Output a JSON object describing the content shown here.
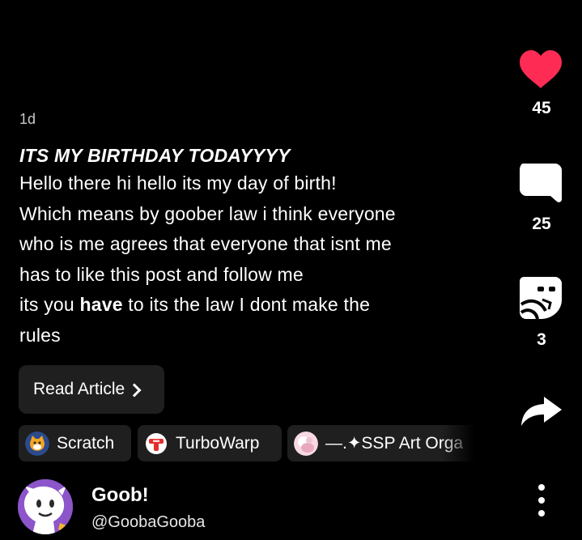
{
  "post": {
    "age": "1d",
    "title": "ITS MY BIRTHDAY TODAYYYY",
    "lines": [
      "Hello there hi hello its my day of birth!",
      "Which means by goober law i think everyone",
      "who is me agrees that everyone that isnt me",
      "has to like this post and follow me"
    ],
    "line5_before": "its you ",
    "line5_bold": "have",
    "line5_after": " to its the law I dont make the",
    "line6": "rules",
    "read_button_label": "Read Article"
  },
  "tags": [
    {
      "label": "Scratch",
      "icon": "scratch-cat-icon"
    },
    {
      "label": "TurboWarp",
      "icon": "turbowarp-icon"
    },
    {
      "label": "—.✦SSP Art Orga",
      "icon": "ssp-art-icon"
    }
  ],
  "author": {
    "name": "Goob!",
    "handle": "@GoobaGooba"
  },
  "actions": {
    "likes": "45",
    "comments": "25",
    "remixes": "3",
    "like_color": "#fe2c55"
  },
  "icons": {
    "like": "heart-icon",
    "comment": "speech-bubble-icon",
    "remix": "remix-face-icon",
    "share": "share-arrow-icon",
    "more": "more-dots-icon"
  }
}
